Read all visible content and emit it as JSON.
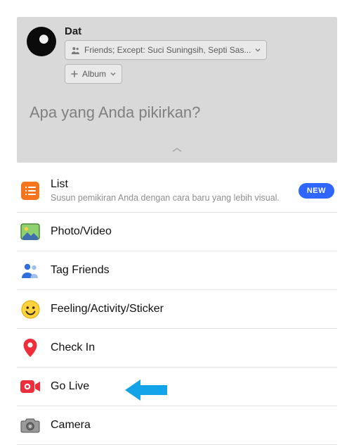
{
  "composer": {
    "user_name": "Dat",
    "audience": {
      "icon": "friends-icon",
      "label": "Friends; Except: Suci Suningsih, Septi Sas..."
    },
    "album": {
      "icon": "plus-icon",
      "label": "Album"
    },
    "placeholder": "Apa yang Anda pikirkan?"
  },
  "menu": [
    {
      "icon": "list-icon",
      "title": "List",
      "subtitle": "Susun pemikiran Anda dengan cara baru yang lebih visual.",
      "badge": "NEW"
    },
    {
      "icon": "photo-icon",
      "title": "Photo/Video"
    },
    {
      "icon": "tag-icon",
      "title": "Tag Friends"
    },
    {
      "icon": "feeling-icon",
      "title": "Feeling/Activity/Sticker"
    },
    {
      "icon": "checkin-icon",
      "title": "Check In"
    },
    {
      "icon": "live-icon",
      "title": "Go Live",
      "highlight": true
    },
    {
      "icon": "camera-icon",
      "title": "Camera"
    }
  ],
  "colors": {
    "badge_bg": "#2f66ff",
    "arrow": "#13a3e8",
    "list_icon": "#f6741b",
    "live_icon": "#ef2e3c",
    "checkin_icon": "#ef2e3c"
  }
}
